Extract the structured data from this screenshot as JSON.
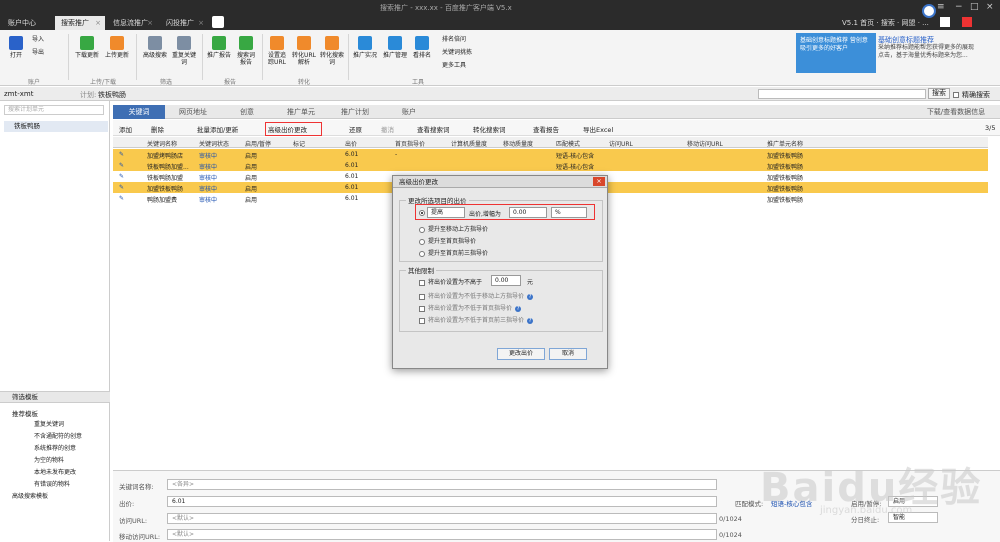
{
  "window": {
    "title": "搜索推广 - xxx.xx - 百度推广客户端 V5.x",
    "right_info": "V5.1 首页 · 搜索 · 网盟 · ...",
    "tabs": [
      {
        "label": "账户中心"
      },
      {
        "label": "搜索推广"
      },
      {
        "label": "信息流推广"
      },
      {
        "label": "闪投推广"
      }
    ]
  },
  "ribbon": {
    "buttons": [
      {
        "label": "打开"
      },
      {
        "label": "导入"
      },
      {
        "label": "导出"
      },
      {
        "label": "下载更新"
      },
      {
        "label": "上传更新"
      },
      {
        "label": "高级搜索"
      },
      {
        "label": "重复关键词"
      },
      {
        "label": "推广报告"
      },
      {
        "label": "搜索词报告"
      },
      {
        "label": "设置追踪URL"
      },
      {
        "label": "转化URL解析"
      },
      {
        "label": "转化搜索词"
      },
      {
        "label": "推广实况"
      },
      {
        "label": "推广管理"
      },
      {
        "label": "看排名"
      },
      {
        "label": "排名倍问"
      },
      {
        "label": "关键词挑拣"
      },
      {
        "label": "更多工具"
      }
    ],
    "groups": [
      "账户",
      "上传/下载",
      "筛选",
      "报告",
      "转化",
      "工具"
    ],
    "banner_title": "基础创意标题推荐",
    "banner_img_text": "基础创意标题推荐 营创意吸引更多的好客户",
    "banner_desc": "采纳推荐标题能帮您获得更多的展现点击，基于海量优秀标题来为您..."
  },
  "userbar": {
    "user": "zmt-xmt",
    "plan_label": "计划:",
    "plan": "铁板鸭肠",
    "search_btn": "搜索",
    "precise": "精确搜索"
  },
  "left_panel": {
    "search_placeholder": "搜索计划单元",
    "tree_root": "铁板鸭肠",
    "filter_title": "筛选模板",
    "recommend_title": "推荐模板",
    "filter_items": [
      "重复关键词",
      "不含通配符的创意",
      "系统推荐的创意",
      "为空的物料",
      "本地未发布更改",
      "有错误的物料"
    ],
    "advanced": "高级搜索模板"
  },
  "content_tabs": [
    "关键词",
    "网页地址",
    "创意",
    "推广单元",
    "推广计划",
    "账户"
  ],
  "right_tab": "下载/查看数据信息",
  "toolbar": {
    "add": "添加",
    "delete": "删除",
    "batch": "批量添加/更新",
    "adv_bid": "高级出价更改",
    "restore": "还原",
    "revoke": "撤消",
    "view_kw": "查看搜索词",
    "convert": "转化搜索词",
    "view_report": "查看报告",
    "export": "导出Excel",
    "count": "3/5"
  },
  "table": {
    "headers": [
      "关键词名称",
      "关键词状态",
      "启用/暂停",
      "标记",
      "出价",
      "首页指导价",
      "计算机质量度",
      "移动质量度",
      "匹配模式",
      "访问URL",
      "移动访问URL",
      "推广单元名称"
    ],
    "rows": [
      {
        "name": "加盟烤鸭肠店",
        "status": "审核中",
        "enable": "启用",
        "bid": "6.01",
        "guide": "-",
        "match": "短语-核心包含",
        "unit": "加盟铁板鸭肠",
        "hl": true
      },
      {
        "name": "铁板鸭肠加盟...",
        "status": "审核中",
        "enable": "启用",
        "bid": "6.01",
        "guide": "",
        "match": "短语-核心包含",
        "unit": "加盟铁板鸭肠",
        "hl": true
      },
      {
        "name": "铁板鸭肠加盟",
        "status": "审核中",
        "enable": "启用",
        "bid": "6.01",
        "guide": "",
        "match": "",
        "unit": "加盟铁板鸭肠",
        "hl": false
      },
      {
        "name": "加盟铁板鸭肠",
        "status": "审核中",
        "enable": "启用",
        "bid": "6.01",
        "guide": "",
        "match": "",
        "unit": "加盟铁板鸭肠",
        "hl": true
      },
      {
        "name": "鸭肠加盟费",
        "status": "审核中",
        "enable": "启用",
        "bid": "6.01",
        "guide": "",
        "match": "",
        "unit": "加盟铁板鸭肠",
        "hl": false
      }
    ]
  },
  "dialog": {
    "title": "高级出价更改",
    "section1": "更改所选项目的出价",
    "op_select": "提高",
    "op_label": "出价,增幅为",
    "value": "0.00",
    "unit": "%",
    "options": [
      "提升至移动上方指导价",
      "提升至首页指导价",
      "提升至首页前三指导价"
    ],
    "section2": "其他限制",
    "limit_label": "将出价设置为不高于",
    "limit_value": "0.00",
    "limit_unit": "元",
    "limits": [
      "将出价设置为不低于移动上方指导价",
      "将出价设置为不低于首页指导价",
      "将出价设置为不低于首页前三指导价"
    ],
    "ok": "更改出价",
    "cancel": "取消"
  },
  "bottom": {
    "kw_label": "关键词名称:",
    "kw_value": "<各异>",
    "bid_label": "出价:",
    "bid_value": "6.01",
    "url_label": "访问URL:",
    "url_value": "<默认>",
    "url_count": "0/1024",
    "murl_label": "移动访问URL:",
    "murl_value": "<默认>",
    "murl_count": "0/1024",
    "match_label": "匹配模式:",
    "match_value": "短语-核心包含",
    "enable_label": "启用/暂停:",
    "enable_value": "启用",
    "sep_label": "分日终止:",
    "sep_value": "智能"
  },
  "watermark": {
    "main": "Baidu经验",
    "sub": "jingyan.baidu.com"
  },
  "colors": {
    "highlight": "#f9c94d",
    "accent": "#3f6fb4",
    "banner": "#3c8fd9"
  }
}
